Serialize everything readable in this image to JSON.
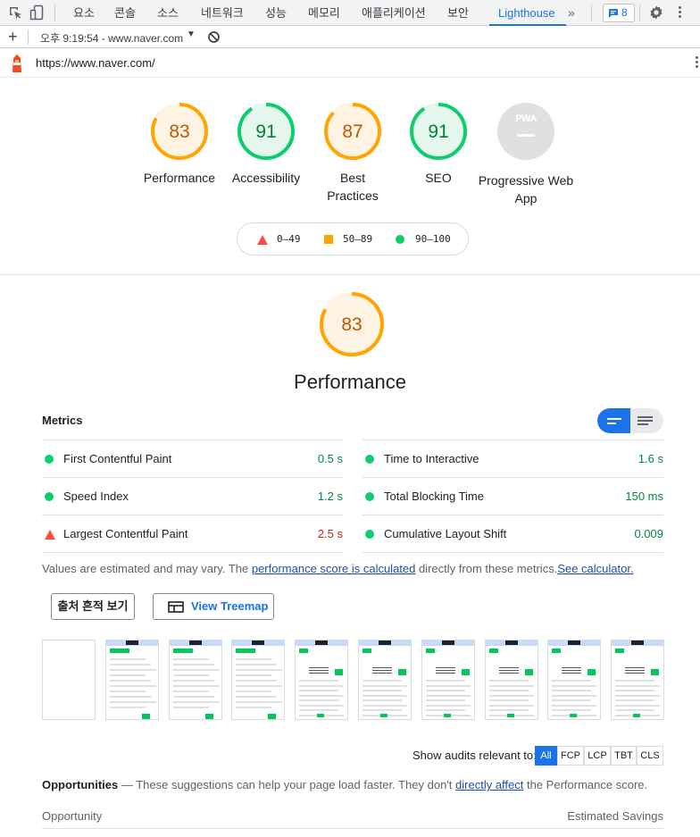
{
  "devtools": {
    "tabs": [
      {
        "label": "요소"
      },
      {
        "label": "콘솔"
      },
      {
        "label": "소스"
      },
      {
        "label": "네트워크"
      },
      {
        "label": "성능"
      },
      {
        "label": "메모리"
      },
      {
        "label": "애플리케이션"
      },
      {
        "label": "보안"
      },
      {
        "label": "Lighthouse"
      }
    ],
    "more_glyph": "»",
    "issues_count": "8",
    "active_color": "#1a73e8"
  },
  "report_bar": {
    "add_glyph": "+",
    "report_label": "오후 9:19:54 - www.naver.com",
    "caret": "▼"
  },
  "url": "https://www.naver.com/",
  "categories": [
    {
      "label": "Performance",
      "score": 83
    },
    {
      "label": "Accessibility",
      "score": 91
    },
    {
      "label": "Best Practices",
      "score": 87
    },
    {
      "label": "SEO",
      "score": 91
    },
    {
      "label": "Progressive Web App",
      "badge": "PWA"
    }
  ],
  "legend": {
    "fail": "0–49",
    "average": "50–89",
    "pass": "90–100"
  },
  "colors": {
    "pass": "#0cce6b",
    "pass_text": "#018642",
    "average": "#ffa400",
    "average_text": "#c33300",
    "fail": "#ff4e42",
    "fail_text": "#c7221f"
  },
  "performance": {
    "score": 83,
    "title": "Performance",
    "metrics_heading": "Metrics",
    "metrics": [
      {
        "name": "First Contentful Paint",
        "value": "0.5 s",
        "status": "pass"
      },
      {
        "name": "Time to Interactive",
        "value": "1.6 s",
        "status": "pass"
      },
      {
        "name": "Speed Index",
        "value": "1.2 s",
        "status": "pass"
      },
      {
        "name": "Total Blocking Time",
        "value": "150 ms",
        "status": "pass"
      },
      {
        "name": "Largest Contentful Paint",
        "value": "2.5 s",
        "status": "fail"
      },
      {
        "name": "Cumulative Layout Shift",
        "value": "0.009",
        "status": "pass"
      }
    ],
    "note_prefix": "Values are estimated and may vary. The ",
    "note_link": "performance score is calculated",
    "note_mid": " directly from these metrics.",
    "note_link2": "See calculator."
  },
  "buttons": {
    "source_trace": "출처 흔적 보기",
    "view_treemap": "View Treemap"
  },
  "filter": {
    "label": "Show audits relevant to:",
    "options": [
      "All",
      "FCP",
      "LCP",
      "TBT",
      "CLS"
    ],
    "selected": "All"
  },
  "opportunities": {
    "heading": "Opportunities",
    "text_prefix": " — These suggestions can help your page load faster. They don't ",
    "link": "directly affect",
    "text_suffix": " the Performance score.",
    "col_left": "Opportunity",
    "col_right": "Estimated Savings"
  }
}
